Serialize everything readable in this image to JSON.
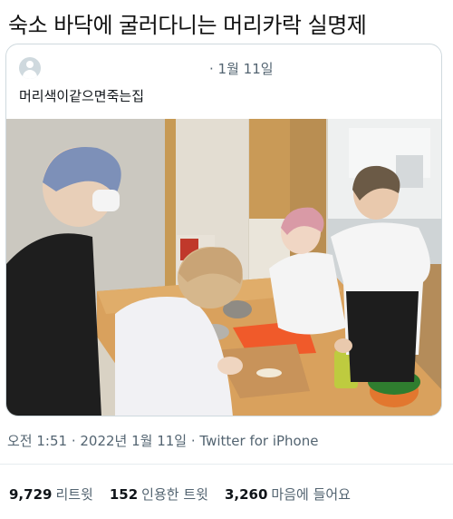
{
  "post": {
    "title": "숙소 바닥에 굴러다니는 머리카락 실명제"
  },
  "quoted_tweet": {
    "date": "· 1월 11일",
    "text": "머리색이같으면죽는집",
    "avatar_icon": "default-avatar-icon",
    "photo": "photo of four people around a kitchen table cutting vegetables"
  },
  "tweet_meta": {
    "line": "오전 1:51 · 2022년 1월 11일 · Twitter for iPhone"
  },
  "stats": {
    "retweets_count": "9,729",
    "retweets_label": "리트윗",
    "quotes_count": "152",
    "quotes_label": "인용한 트윗",
    "likes_count": "3,260",
    "likes_label": "마음에 들어요"
  },
  "colors": {
    "text_primary": "#0f1419",
    "text_secondary": "#536471",
    "border": "#cfd9de"
  }
}
